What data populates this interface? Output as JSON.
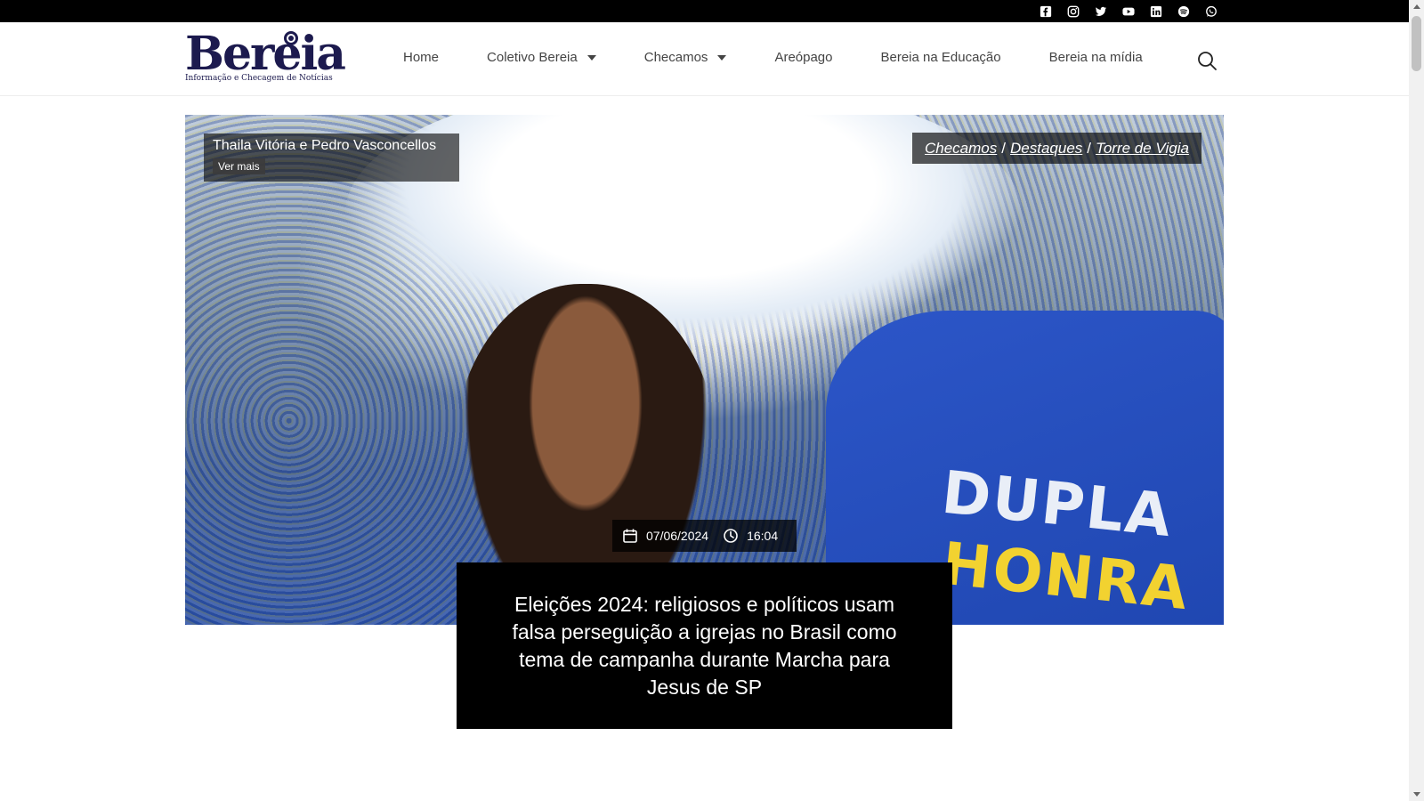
{
  "social": {
    "icons": [
      "facebook-icon",
      "instagram-icon",
      "twitter-icon",
      "youtube-icon",
      "linkedin-icon",
      "spotify-icon",
      "whatsapp-icon"
    ]
  },
  "header": {
    "logo_text": "Bereia",
    "logo_tagline": "Informação e Checagem de Notícias",
    "nav": [
      {
        "label": "Home",
        "dropdown": false
      },
      {
        "label": "Coletivo Bereia",
        "dropdown": true
      },
      {
        "label": "Checamos",
        "dropdown": true
      },
      {
        "label": "Areópago",
        "dropdown": false
      },
      {
        "label": "Bereia na Educação",
        "dropdown": false
      },
      {
        "label": "Bereia na mídia",
        "dropdown": false
      }
    ],
    "search_icon": "search-icon"
  },
  "article": {
    "author": "Thaila Vitória e Pedro Vasconcellos",
    "author_more": "Ver mais",
    "categories": [
      "Checamos",
      "Destaques",
      "Torre de Vigia"
    ],
    "category_separator": "/",
    "date": "07/06/2024",
    "time": "16:04",
    "title": "Eleições 2024: religiosos e políticos usam falsa perseguição a igrejas no Brasil como tema de campanha durante Marcha para Jesus de SP",
    "image_text_top": "DUPLA",
    "image_text_bottom": "HONRA"
  },
  "colors": {
    "brand": "#1c1a4e",
    "topbar": "#000000",
    "title_bg": "#000000"
  }
}
